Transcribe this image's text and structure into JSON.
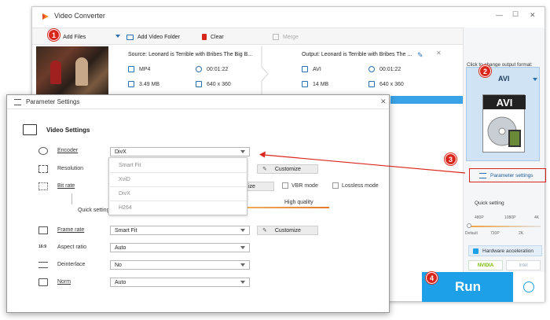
{
  "app": {
    "title": "Video Converter",
    "window_controls": [
      "—",
      "☐",
      "✕"
    ]
  },
  "toolbar": {
    "add_files": "Add Files",
    "add_video_folder": "Add Video Folder",
    "clear": "Clear",
    "merge": "Merge"
  },
  "file": {
    "source": "Source: Leonard is Terrible with Bribes  The Big B...",
    "output": "Output: Leonard is Terrible with Bribes  The ...",
    "src_format": "MP4",
    "src_duration": "00:01:22",
    "src_size": "3.49 MB",
    "src_resolution": "640 x 360",
    "out_format": "AVI",
    "out_duration": "00:01:22",
    "out_size": "14 MB",
    "out_resolution": "640 x 360"
  },
  "right_panel": {
    "hint": "Click to change output format:",
    "format": "AVI",
    "parameter_settings": "Parameter settings",
    "quick_setting": "Quick setting",
    "scale_top": [
      "480P",
      "1080P",
      "4K"
    ],
    "scale_bottom": [
      "Default",
      "720P",
      "2K"
    ],
    "hw_accel": "Hardware acceleration",
    "nvidia": "NVIDIA",
    "intel": "Intel",
    "run": "Run"
  },
  "dialog": {
    "title": "Parameter Settings",
    "section": "Video Settings",
    "encoder_label": "Encoder",
    "encoder_value": "DivX",
    "encoder_options": [
      "Smart Fit",
      "XviD",
      "DivX",
      "H264"
    ],
    "resolution_label": "Resolution",
    "customize": "Customize",
    "bitrate_label": "Bit rate",
    "bitrate_customize": "ize",
    "vbr_mode": "VBR mode",
    "lossless_mode": "Lossless mode",
    "quick_setting": "Quick setting",
    "high_quality": "High quality",
    "framerate_label": "Frame rate",
    "framerate_value": "Smart Fit",
    "aspect_label": "Aspect ratio",
    "aspect_value": "Auto",
    "deinterlace_label": "Deinterlace",
    "deinterlace_value": "No",
    "norm_label": "Norm",
    "norm_value": "Auto"
  },
  "badges": [
    "1",
    "2",
    "3",
    "4"
  ],
  "colors": {
    "accent_blue": "#1ea0e8",
    "badge_red": "#d9261c",
    "highlight_box": "#d9261c"
  }
}
